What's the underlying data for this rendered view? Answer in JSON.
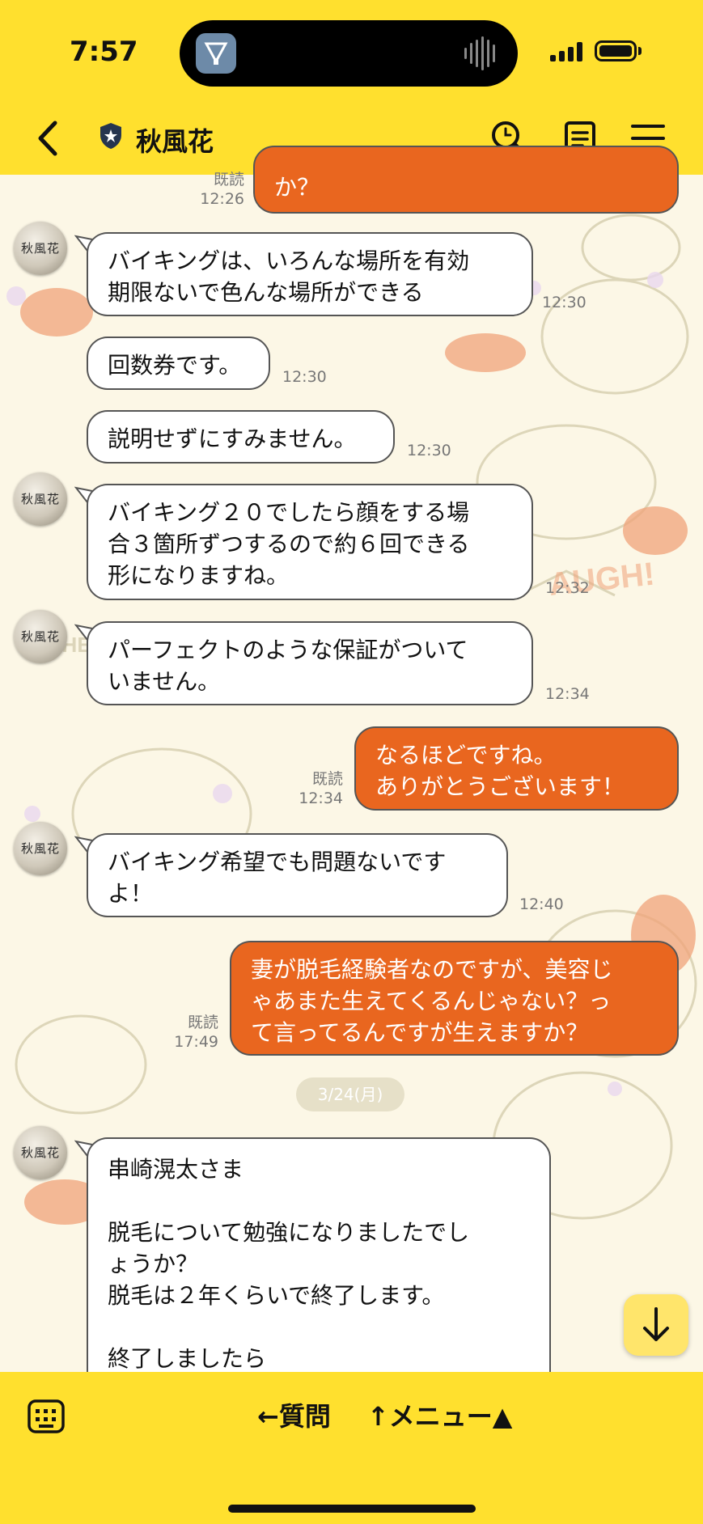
{
  "status_bar": {
    "time": "7:57"
  },
  "header": {
    "contact_name": "秋風花"
  },
  "avatar_label": "秋風花",
  "messages": [
    {
      "dir": "out",
      "text": "か？",
      "read_label": "既読",
      "time": "12:26"
    },
    {
      "dir": "in",
      "text": "バイキングは、いろんな場所を有効\n期限ないで色んな場所ができる",
      "time": "12:30"
    },
    {
      "dir": "in",
      "text": "回数券です。",
      "time": "12:30"
    },
    {
      "dir": "in",
      "text": "説明せずにすみません。",
      "time": "12:30"
    },
    {
      "dir": "in",
      "text": "バイキング２０でしたら顔をする場\n合３箇所ずつするので約６回できる\n形になりますね。",
      "time": "12:32"
    },
    {
      "dir": "in",
      "text": "パーフェクトのような保証がついて\nいません。",
      "time": "12:34"
    },
    {
      "dir": "out",
      "text": "なるほどですね。\nありがとうございます！",
      "read_label": "既読",
      "time": "12:34"
    },
    {
      "dir": "in",
      "text": "バイキング希望でも問題ないです\nよ！",
      "time": "12:40"
    },
    {
      "dir": "out",
      "text": "妻が脱毛経験者なのですが、美容じ\nゃあまた生えてくるんじゃない？っ\nて言ってるんですが生えますか？",
      "read_label": "既読",
      "time": "17:49"
    },
    {
      "dir": "in",
      "text": "串崎滉太さま\n\n脱毛について勉強になりましたでし\nょうか？\n脱毛は２年くらいで終了します。\n\n終了しましたら"
    }
  ],
  "date_separator": "3/24(月)",
  "bottom_bar": {
    "question_label": "←質問",
    "menu_label": "↑メニュー▲"
  },
  "colors": {
    "theme_yellow": "#FFE02E",
    "outgoing_bubble": "#E9661F",
    "incoming_bubble": "#FFFFFF"
  },
  "icons": [
    "back-chevron-icon",
    "verified-shield-icon",
    "search-icon",
    "notes-icon",
    "menu-icon",
    "keyboard-icon",
    "scroll-down-arrow-icon"
  ]
}
